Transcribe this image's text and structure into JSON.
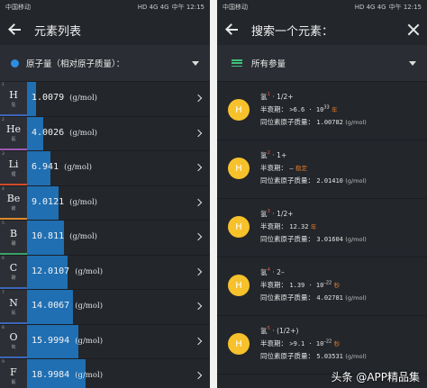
{
  "left": {
    "status": {
      "carrier": "中国移动",
      "icons": "HD 4G 4G",
      "time": "中午 12:15"
    },
    "title": "元素列表",
    "selector_label": "原子量（相对原子质量）：",
    "accent": "#1f6fb2",
    "elements": [
      {
        "num": "1",
        "sym": "H",
        "cn": "氢",
        "value": "1.0079",
        "unit": "(g/mol)",
        "fill": 0.05,
        "stripe": "#3e66b7"
      },
      {
        "num": "2",
        "sym": "He",
        "cn": "氦",
        "value": "4.0026",
        "unit": "(g/mol)",
        "fill": 0.09,
        "stripe": "#9e58b5"
      },
      {
        "num": "3",
        "sym": "Li",
        "cn": "锂",
        "value": "6.941",
        "unit": "(g/mol)",
        "fill": 0.13,
        "stripe": "#d14a2b"
      },
      {
        "num": "4",
        "sym": "Be",
        "cn": "铍",
        "value": "9.0121",
        "unit": "(g/mol)",
        "fill": 0.17,
        "stripe": "#dd8a2c"
      },
      {
        "num": "5",
        "sym": "B",
        "cn": "硼",
        "value": "10.811",
        "unit": "(g/mol)",
        "fill": 0.2,
        "stripe": "#39a46a"
      },
      {
        "num": "6",
        "sym": "C",
        "cn": "碳",
        "value": "12.0107",
        "unit": "(g/mol)",
        "fill": 0.22,
        "stripe": "#3e66b7"
      },
      {
        "num": "7",
        "sym": "N",
        "cn": "氮",
        "value": "14.0067",
        "unit": "(g/mol)",
        "fill": 0.25,
        "stripe": "#3e66b7"
      },
      {
        "num": "8",
        "sym": "O",
        "cn": "氧",
        "value": "15.9994",
        "unit": "(g/mol)",
        "fill": 0.28,
        "stripe": "#3e66b7"
      },
      {
        "num": "9",
        "sym": "F",
        "cn": "氟",
        "value": "18.9984",
        "unit": "(g/mol)",
        "fill": 0.32,
        "stripe": "#9e58b5"
      }
    ]
  },
  "right": {
    "status": {
      "carrier": "中国移动",
      "icons": "HD 4G 4G",
      "time": "中午 12:15"
    },
    "title": "搜索一个元素：",
    "filter_label": "所有参量",
    "half_life_label": "半衰期：",
    "mass_label": "同位素原子质量：",
    "isotopes": [
      {
        "symbol": "H",
        "name": "氢",
        "mass_number": "1",
        "spin": "1/2+",
        "half_life": ">6.6 · 10",
        "half_life_exp": "33",
        "half_life_unit": "年",
        "mass": "1.00782",
        "unit": "(g/mol)"
      },
      {
        "symbol": "H",
        "name": "氢",
        "mass_number": "2",
        "spin": "1+",
        "half_life": "–",
        "half_life_exp": "",
        "half_life_unit": "稳定",
        "mass": "2.01410",
        "unit": "(g/mol)"
      },
      {
        "symbol": "H",
        "name": "氢",
        "mass_number": "3",
        "spin": "1/2+",
        "half_life": "12.32",
        "half_life_exp": "",
        "half_life_unit": "年",
        "mass": "3.01604",
        "unit": "(g/mol)"
      },
      {
        "symbol": "H",
        "name": "氢",
        "mass_number": "4",
        "spin": "2–",
        "half_life": "1.39 · 10",
        "half_life_exp": "–22",
        "half_life_unit": "秒",
        "mass": "4.02781",
        "unit": "(g/mol)"
      },
      {
        "symbol": "H",
        "name": "氢",
        "mass_number": "5",
        "spin": "(1/2+)",
        "half_life": ">9.1 · 10",
        "half_life_exp": "–22",
        "half_life_unit": "秒",
        "mass": "5.03531",
        "unit": "(g/mol)"
      }
    ]
  },
  "watermark": "头条 @APP精品集"
}
